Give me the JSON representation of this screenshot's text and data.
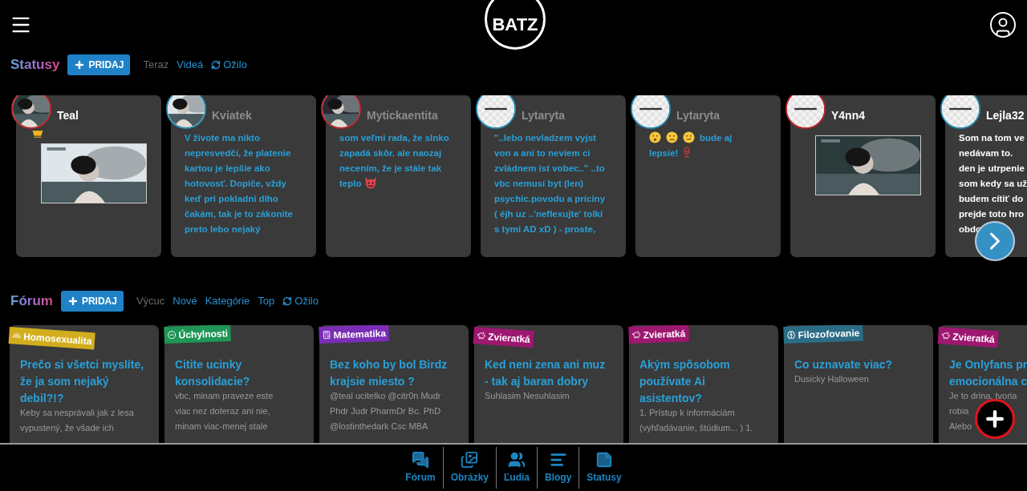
{
  "header": {
    "logo": "BATZ"
  },
  "statuses": {
    "title": "Statusy",
    "add_button": "PRIDAJ",
    "tabs": [
      {
        "label": "Teraz",
        "selected": true
      },
      {
        "label": "Videá",
        "selected": false
      },
      {
        "label": "Ožilo",
        "selected": false,
        "kind": "refresh"
      }
    ],
    "cards": [
      {
        "name": "Teal",
        "name_light": true,
        "avatar": {
          "kind": "picture",
          "color": "#c0272d"
        },
        "body": [
          {
            "kind": "crown"
          },
          {
            "kind": "picture"
          }
        ]
      },
      {
        "name": "Kviatek",
        "name_light": false,
        "avatar": {
          "kind": "picture",
          "color": "#2a8fb8"
        },
        "body": [
          {
            "kind": "text",
            "text": "V živote ma nikto\nnepresvedčí, že platenie\nkartou je lepšie ako\nhotovosť. Dopiče, vždy\nkeď pri pokladni dlho\nčakám, tak je to zákonite\npreto lebo nejaký"
          }
        ]
      },
      {
        "name": "Mytickaentita",
        "name_light": false,
        "avatar": {
          "kind": "picture",
          "color": "#c0272d"
        },
        "body": [
          {
            "kind": "text",
            "text": "som veľmi rada, že slnko\nzapadá skôr. ale naozaj\nnecením, že je stále tak"
          },
          {
            "kind": "break"
          },
          {
            "kind": "text",
            "text": "teplo"
          },
          {
            "kind": "devil"
          }
        ]
      },
      {
        "name": "Lytaryta",
        "name_light": false,
        "avatar": {
          "kind": "placeholder",
          "color": "#2a8fb8"
        },
        "body": [
          {
            "kind": "text",
            "text": "\"..lebo nevladzem vyjst\nvon a ani to neviem ci\nzvládnem ist vobec..\" ..to\nvbc nemusí byt (len)\npsychic.povodu a príciny\n( éjh uz ..'neflexujte' tolkí\ns tymi AD xD ) - proste,"
          }
        ]
      },
      {
        "name": "Lytaryta",
        "name_light": false,
        "avatar": {
          "kind": "placeholder",
          "color": "#2a8fb8"
        },
        "body": [
          {
            "kind": "smiley"
          },
          {
            "kind": "sad"
          },
          {
            "kind": "confused"
          },
          {
            "kind": "text",
            "text": "bude aj"
          },
          {
            "kind": "break"
          },
          {
            "kind": "text",
            "text": "lepsie!"
          },
          {
            "kind": "wine"
          }
        ]
      },
      {
        "name": "Y4nn4",
        "name_light": true,
        "avatar": {
          "kind": "placeholder",
          "color": "#c0272d"
        },
        "body": [
          {
            "kind": "picture"
          }
        ]
      },
      {
        "name": "Lejla32",
        "name_light": true,
        "avatar": {
          "kind": "placeholder",
          "color": "#2a8fb8"
        },
        "body": [
          {
            "kind": "white_text",
            "text": "Som na tom ve\nnedávam to.\nden je utrpenie\nsom kedy sa už\nbudem cítiť do\nprejde toto hro\nobdo"
          }
        ]
      }
    ]
  },
  "forum": {
    "title": "Fórum",
    "add_button": "PRIDAJ",
    "tabs": [
      {
        "label": "Výcuc",
        "selected": true
      },
      {
        "label": "Nové",
        "selected": false
      },
      {
        "label": "Kategórie",
        "selected": false
      },
      {
        "label": "Top",
        "selected": false
      },
      {
        "label": "Ožilo",
        "selected": false,
        "kind": "refresh"
      }
    ],
    "cards": [
      {
        "tag": {
          "label": "Homosexualita",
          "kind": "rainbow",
          "color": "#d2ae1e"
        },
        "title": "Prečo si všetci myslíte,\nže ja som nejaký\ndebil?!?",
        "body": "Keby sa nesprávali jak z lesa\nvypustený, že všade ich"
      },
      {
        "tag": {
          "label": "Úchylnosti",
          "kind": "minus",
          "color": "#1f9656"
        },
        "title": "Citite ucinky\nkonsolidacie?",
        "body": "vbc, minam praveze este\nviac nez doteraz ani nie,\nminam viac-menej stale"
      },
      {
        "tag": {
          "label": "Matematika",
          "kind": "calculator",
          "color": "#7a2db5"
        },
        "title": "Bez koho by bol Birdz\nkrajsie miesto ?",
        "body": "@teal ucitelko @citr0n Mudr\nPhdr Judr PharmDr Bc. PhD\n@lostinthedark Csc MBA"
      },
      {
        "tag": {
          "label": "Zvieratká",
          "kind": "animal",
          "color": "#9e1770"
        },
        "title": "Ked neni zena ani muz\n- tak aj baran dobry",
        "body": "Suhlasim Nesuhlasim"
      },
      {
        "tag": {
          "label": "Zvieratká",
          "kind": "animal",
          "color": "#9e1770"
        },
        "title": "Akým spôsobom\npoužívate Ai\nasistentov?",
        "body": "1. Prístup k informáciám\n(vyhľadávanie, štúdium... ) 1."
      },
      {
        "tag": {
          "label": "Filozofovanie",
          "kind": "brain",
          "color": "#2b6c86"
        },
        "title": "Co uznavate viac?",
        "body": "Dusicky Halloween"
      },
      {
        "tag": {
          "label": "Zvieratká",
          "kind": "animal",
          "color": "#9e1770"
        },
        "title": "Je Onlyfans pr\nemocionálna c",
        "body": "Je to drina, tvoria\nrobia\nAlebo"
      }
    ]
  },
  "bottom_nav": [
    {
      "label": "Fórum",
      "kind": "forum"
    },
    {
      "label": "Obrázky",
      "kind": "images"
    },
    {
      "label": "Ľudia",
      "kind": "people"
    },
    {
      "label": "Blogy",
      "kind": "blogs"
    },
    {
      "label": "Statusy",
      "kind": "statuses"
    }
  ]
}
